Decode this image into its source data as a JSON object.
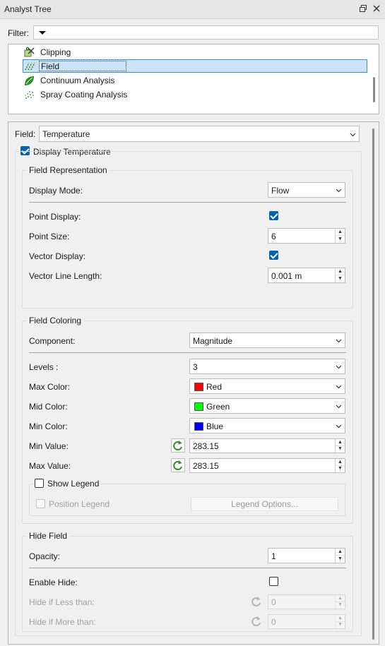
{
  "window": {
    "title": "Analyst Tree"
  },
  "filter": {
    "label": "Filter:",
    "value": ""
  },
  "tree": {
    "items": [
      {
        "label": "Clipping",
        "icon": "clipping-icon",
        "selected": false
      },
      {
        "label": "Field",
        "icon": "field-icon",
        "selected": true
      },
      {
        "label": "Continuum Analysis",
        "icon": "continuum-icon",
        "selected": false
      },
      {
        "label": "Spray Coating Analysis",
        "icon": "spray-icon",
        "selected": false
      }
    ]
  },
  "field_select": {
    "label": "Field:",
    "value": "Temperature"
  },
  "display": {
    "label": "Display Temperature",
    "checked": true
  },
  "representation": {
    "title": "Field Representation",
    "display_mode": {
      "label": "Display Mode:",
      "value": "Flow"
    },
    "point_display": {
      "label": "Point Display:",
      "checked": true
    },
    "point_size": {
      "label": "Point Size:",
      "value": "6"
    },
    "vector_display": {
      "label": "Vector Display:",
      "checked": true
    },
    "vector_length": {
      "label": "Vector Line Length:",
      "value": "0.001 m"
    }
  },
  "coloring": {
    "title": "Field Coloring",
    "component": {
      "label": "Component:",
      "value": "Magnitude"
    },
    "levels": {
      "label": "Levels :",
      "value": "3"
    },
    "max_color": {
      "label": "Max Color:",
      "value": "Red",
      "color": "#ff0000"
    },
    "mid_color": {
      "label": "Mid Color:",
      "value": "Green",
      "color": "#00ff00"
    },
    "min_color": {
      "label": "Min Color:",
      "value": "Blue",
      "color": "#0000ff"
    },
    "min_value": {
      "label": "Min Value:",
      "value": "283.15"
    },
    "max_value": {
      "label": "Max Value:",
      "value": "283.15"
    },
    "show_legend": {
      "label": "Show Legend",
      "checked": false
    },
    "position_legend": {
      "label": "Position Legend",
      "checked": false
    },
    "legend_options": {
      "label": "Legend Options..."
    }
  },
  "hide": {
    "title": "Hide Field",
    "opacity": {
      "label": "Opacity:",
      "value": "1"
    },
    "enable_hide": {
      "label": "Enable Hide:",
      "checked": false
    },
    "less_than": {
      "label": "Hide if Less than:",
      "value": "0"
    },
    "more_than": {
      "label": "Hide if More than:",
      "value": "0"
    }
  },
  "colors": {
    "accent": "#0063b1",
    "selection_bg": "#cce4f7",
    "selection_border": "#3c8fd9"
  }
}
